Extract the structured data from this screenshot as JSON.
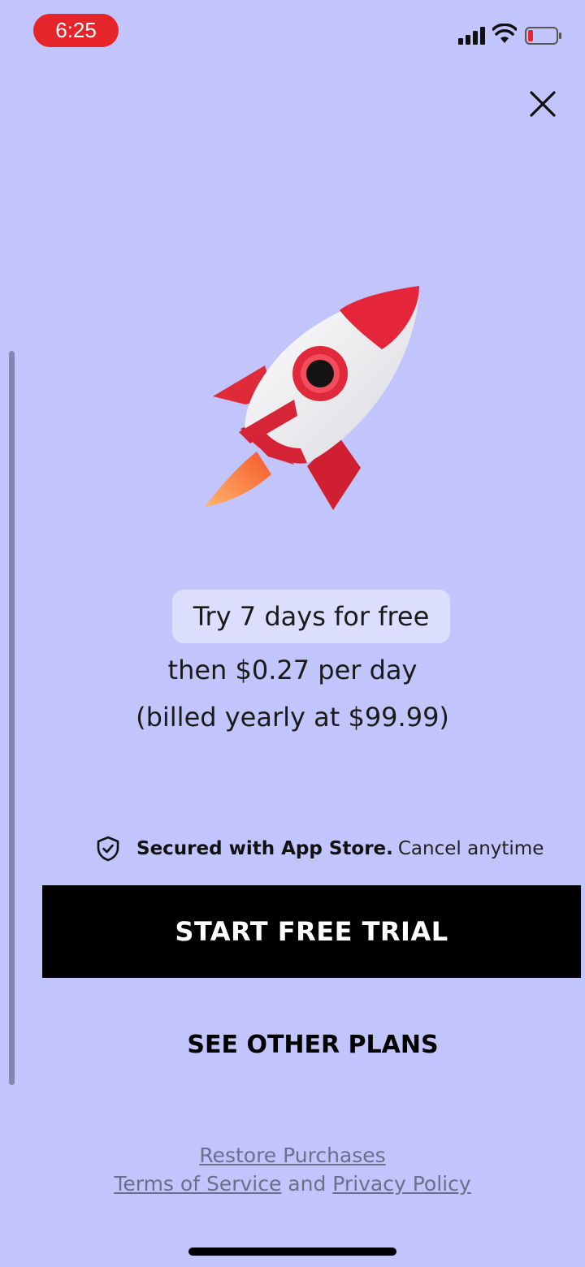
{
  "status_bar": {
    "time": "6:25",
    "time_pill_color": "#e5252a",
    "signal_icon": "cellular-signal-icon",
    "wifi_icon": "wifi-icon",
    "battery_icon": "battery-low-icon",
    "battery_level": 0.1
  },
  "close_icon": "close-icon",
  "hero_icon": "rocket-icon",
  "offer": {
    "trial": "Try 7 days for free",
    "price": "then $0.27 per day",
    "billed": "(billed yearly at $99.99)"
  },
  "security": {
    "icon": "shield-check-icon",
    "strong_text": "Secured with App Store.",
    "rest_text": "Cancel anytime"
  },
  "buttons": {
    "start_trial": "START FREE TRIAL",
    "other_plans": "SEE OTHER PLANS"
  },
  "footer": {
    "restore": "Restore Purchases",
    "terms": "Terms of Service",
    "and": " and ",
    "privacy": "Privacy Policy"
  },
  "colors": {
    "background": "#c2c5fb",
    "primary_button": "#000000",
    "link": "#6c6f8c",
    "trial_pill": "#dcdefd"
  }
}
